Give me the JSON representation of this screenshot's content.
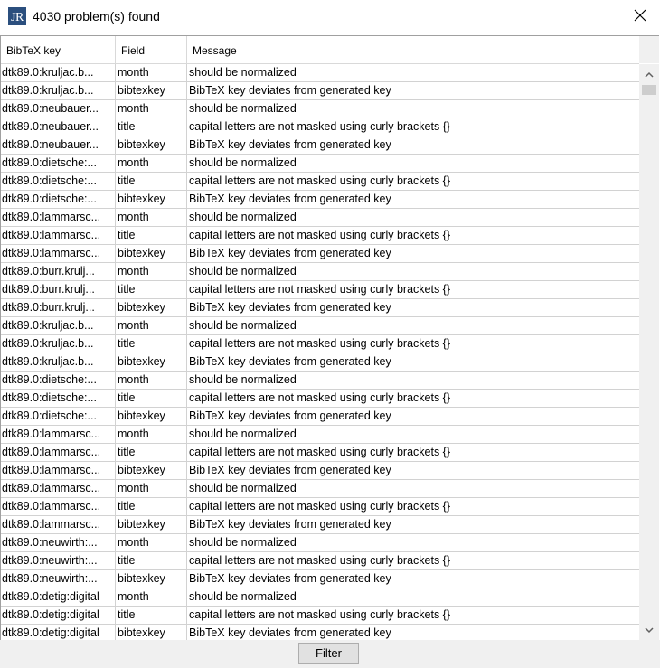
{
  "window": {
    "title": "4030 problem(s) found",
    "icon": "jabref-logo-icon",
    "close_icon": "close-icon"
  },
  "table": {
    "columns": [
      "BibTeX key",
      "Field",
      "Message"
    ],
    "rows": [
      {
        "key": "dtk89.0:kruljac.b...",
        "field": "month",
        "message": "should be normalized"
      },
      {
        "key": "dtk89.0:kruljac.b...",
        "field": "bibtexkey",
        "message": "BibTeX key deviates from generated key"
      },
      {
        "key": "dtk89.0:neubauer...",
        "field": "month",
        "message": "should be normalized"
      },
      {
        "key": "dtk89.0:neubauer...",
        "field": "title",
        "message": "capital letters are not masked using curly brackets {}"
      },
      {
        "key": "dtk89.0:neubauer...",
        "field": "bibtexkey",
        "message": "BibTeX key deviates from generated key"
      },
      {
        "key": "dtk89.0:dietsche:...",
        "field": "month",
        "message": "should be normalized"
      },
      {
        "key": "dtk89.0:dietsche:...",
        "field": "title",
        "message": "capital letters are not masked using curly brackets {}"
      },
      {
        "key": "dtk89.0:dietsche:...",
        "field": "bibtexkey",
        "message": "BibTeX key deviates from generated key"
      },
      {
        "key": "dtk89.0:lammarsc...",
        "field": "month",
        "message": "should be normalized"
      },
      {
        "key": "dtk89.0:lammarsc...",
        "field": "title",
        "message": "capital letters are not masked using curly brackets {}"
      },
      {
        "key": "dtk89.0:lammarsc...",
        "field": "bibtexkey",
        "message": "BibTeX key deviates from generated key"
      },
      {
        "key": "dtk89.0:burr.krulj...",
        "field": "month",
        "message": "should be normalized"
      },
      {
        "key": "dtk89.0:burr.krulj...",
        "field": "title",
        "message": "capital letters are not masked using curly brackets {}"
      },
      {
        "key": "dtk89.0:burr.krulj...",
        "field": "bibtexkey",
        "message": "BibTeX key deviates from generated key"
      },
      {
        "key": "dtk89.0:kruljac.b...",
        "field": "month",
        "message": "should be normalized"
      },
      {
        "key": "dtk89.0:kruljac.b...",
        "field": "title",
        "message": "capital letters are not masked using curly brackets {}"
      },
      {
        "key": "dtk89.0:kruljac.b...",
        "field": "bibtexkey",
        "message": "BibTeX key deviates from generated key"
      },
      {
        "key": "dtk89.0:dietsche:...",
        "field": "month",
        "message": "should be normalized"
      },
      {
        "key": "dtk89.0:dietsche:...",
        "field": "title",
        "message": "capital letters are not masked using curly brackets {}"
      },
      {
        "key": "dtk89.0:dietsche:...",
        "field": "bibtexkey",
        "message": "BibTeX key deviates from generated key"
      },
      {
        "key": "dtk89.0:lammarsc...",
        "field": "month",
        "message": "should be normalized"
      },
      {
        "key": "dtk89.0:lammarsc...",
        "field": "title",
        "message": "capital letters are not masked using curly brackets {}"
      },
      {
        "key": "dtk89.0:lammarsc...",
        "field": "bibtexkey",
        "message": "BibTeX key deviates from generated key"
      },
      {
        "key": "dtk89.0:lammarsc...",
        "field": "month",
        "message": "should be normalized"
      },
      {
        "key": "dtk89.0:lammarsc...",
        "field": "title",
        "message": "capital letters are not masked using curly brackets {}"
      },
      {
        "key": "dtk89.0:lammarsc...",
        "field": "bibtexkey",
        "message": "BibTeX key deviates from generated key"
      },
      {
        "key": "dtk89.0:neuwirth:...",
        "field": "month",
        "message": "should be normalized"
      },
      {
        "key": "dtk89.0:neuwirth:...",
        "field": "title",
        "message": "capital letters are not masked using curly brackets {}"
      },
      {
        "key": "dtk89.0:neuwirth:...",
        "field": "bibtexkey",
        "message": "BibTeX key deviates from generated key"
      },
      {
        "key": "dtk89.0:detig:digital",
        "field": "month",
        "message": "should be normalized"
      },
      {
        "key": "dtk89.0:detig:digital",
        "field": "title",
        "message": "capital letters are not masked using curly brackets {}"
      },
      {
        "key": "dtk89.0:detig:digital",
        "field": "bibtexkey",
        "message": "BibTeX key deviates from generated key"
      }
    ]
  },
  "scrollbar": {
    "up_icon": "chevron-up-icon",
    "down_icon": "chevron-down-icon"
  },
  "footer": {
    "filter_label": "Filter"
  },
  "colors": {
    "icon_bg": "#2b4f7e",
    "border": "#a0a0a0",
    "grid": "#d2d2d2",
    "footer_bg": "#f0f0f0"
  }
}
